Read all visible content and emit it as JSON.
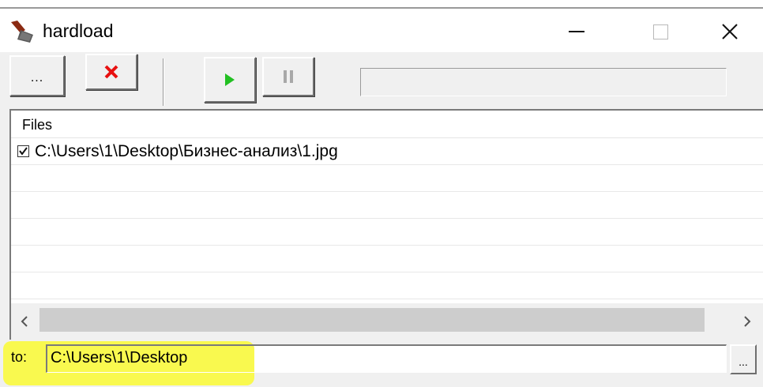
{
  "window": {
    "title": "hardload",
    "app_icon": "shovel-icon"
  },
  "toolbar": {
    "add_label": "...",
    "delete_icon": "red-x-icon",
    "start_icon": "play-icon",
    "pause_icon": "pause-icon",
    "progress": 0
  },
  "files": {
    "header": "Files",
    "items": [
      {
        "path": "C:\\Users\\1\\Desktop\\Бизнес-анализ\\1.jpg",
        "checked": true
      }
    ]
  },
  "destination": {
    "label": "to:",
    "value": "C:\\Users\\1\\Desktop",
    "browse_label": "..."
  },
  "colors": {
    "highlight": "#fafa33",
    "delete_red": "#e81010",
    "play_green": "#22c022"
  }
}
